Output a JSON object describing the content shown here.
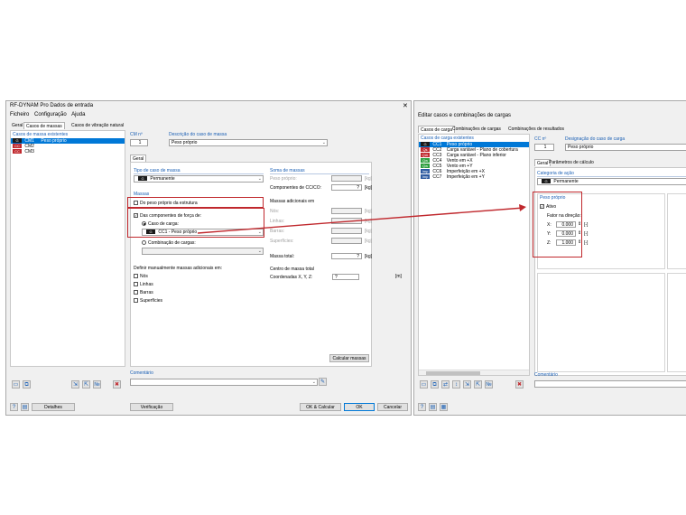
{
  "left": {
    "title": "RF-DYNAM Pro Dados de entrada",
    "menu": [
      "Ficheiro",
      "Configuração",
      "Ajuda"
    ],
    "tabs": [
      "Geral",
      "Casos de massas",
      "Casos de vibração natural"
    ],
    "list_header": "Casos de massa existentes",
    "list": [
      {
        "code": "CM1",
        "tag": "G",
        "tag_color": "#1a1a1a",
        "name": "Peso próprio"
      },
      {
        "code": "CM2",
        "tag": "CC",
        "tag_color": "#c0282d",
        "name": ""
      },
      {
        "code": "CM3",
        "tag": "CC",
        "tag_color": "#c0282d",
        "name": ""
      }
    ],
    "cm_label": "CM nº",
    "cm_value": "1",
    "desc_label": "Descrição do caso de massa",
    "desc_value": "Peso próprio",
    "subtab": "Geral",
    "tipo_label": "Tipo de caso de massa",
    "tipo_value": "Permanente",
    "tipo_tag": "G",
    "massas_label": "Massas",
    "chk_peso": "Do peso próprio da estrutura",
    "chk_comp": "Das componentes de força de:",
    "rad_caso": "Caso de carga:",
    "caso_value": "CC1 - Peso próprio",
    "caso_tag": "G",
    "rad_comb": "Combinação de cargas:",
    "definir_label": "Definir manualmente massas adicionais em:",
    "definir_items": [
      "Nós",
      "Linhas",
      "Barras",
      "Superfícies"
    ],
    "soma_label": "Soma de massas",
    "soma_rows": [
      {
        "label": "Peso próprio:",
        "value": "",
        "unit": "[kg]",
        "disabled": true
      },
      {
        "label": "Componentes de CC/CO:",
        "value": "?",
        "unit": "[kg]",
        "disabled": false
      }
    ],
    "adicionais_label": "Massas adicionais em",
    "adicionais_rows": [
      {
        "label": "Nós:",
        "unit": "[kg]"
      },
      {
        "label": "Linhas:",
        "unit": "[kg]"
      },
      {
        "label": "Barras:",
        "unit": "[kg]"
      },
      {
        "label": "Superfícies:",
        "unit": "[kg]"
      }
    ],
    "total_label": "Massa total:",
    "total_value": "?",
    "total_unit": "[kg]",
    "centro_label": "Centro de massa total",
    "coord_label": "Coordenadas X, Y, Z:",
    "coord_value": "?",
    "coord_unit": "[m]",
    "calc_button": "Calcular massas",
    "comentario_label": "Comentário",
    "footer": {
      "detalhes": "Detalhes",
      "verificacao": "Verificação",
      "ok_calc": "OK & Calcular",
      "ok": "OK",
      "cancelar": "Cancelar"
    },
    "close_glyph": "✕"
  },
  "right": {
    "title": "Editar casos e combinações de cargas",
    "tabs": [
      "Casos de carga",
      "Combinações de cargas",
      "Combinações de resultados"
    ],
    "list_header": "Casos de carga existentes",
    "list": [
      {
        "code": "CC1",
        "tag": "G",
        "tag_color": "#1a1a1a",
        "name": "Peso próprio"
      },
      {
        "code": "CC2",
        "tag": "Qs",
        "tag_color": "#c0282d",
        "name": "Carga variável - Plano de cobertura"
      },
      {
        "code": "CC3",
        "tag": "QiA",
        "tag_color": "#c0282d",
        "name": "Carga variável - Plano inferior"
      },
      {
        "code": "CC4",
        "tag": "Qw",
        "tag_color": "#2e9e3e",
        "name": "Vento em +X"
      },
      {
        "code": "CC5",
        "tag": "Qw",
        "tag_color": "#2e9e3e",
        "name": "Vento em +Y"
      },
      {
        "code": "CC6",
        "tag": "Imp",
        "tag_color": "#2c5aa0",
        "name": "Imperfeição em +X"
      },
      {
        "code": "CC7",
        "tag": "Imp",
        "tag_color": "#2c5aa0",
        "name": "Imperfeição em +Y"
      }
    ],
    "cc_label": "CC nº",
    "cc_value": "1",
    "desig_label": "Designação do caso de carga",
    "desig_value": "Peso próprio",
    "subtabs": [
      "Geral",
      "Parâmetros de cálculo"
    ],
    "categoria_label": "Categoria de ação",
    "categoria_value": "Permanente",
    "categoria_tag": "G",
    "peso_label": "Peso próprio",
    "ativo_label": "Ativo",
    "fator_label": "Fator na direção:",
    "fatores": [
      {
        "axis": "X:",
        "value": "0.000"
      },
      {
        "axis": "Y:",
        "value": "0.000"
      },
      {
        "axis": "Z:",
        "value": "1.000"
      }
    ],
    "comentario_label": "Comentário"
  },
  "colors": {
    "accent": "#0078d7",
    "highlight": "#c0282d",
    "section_text": "#1a5fb4"
  }
}
